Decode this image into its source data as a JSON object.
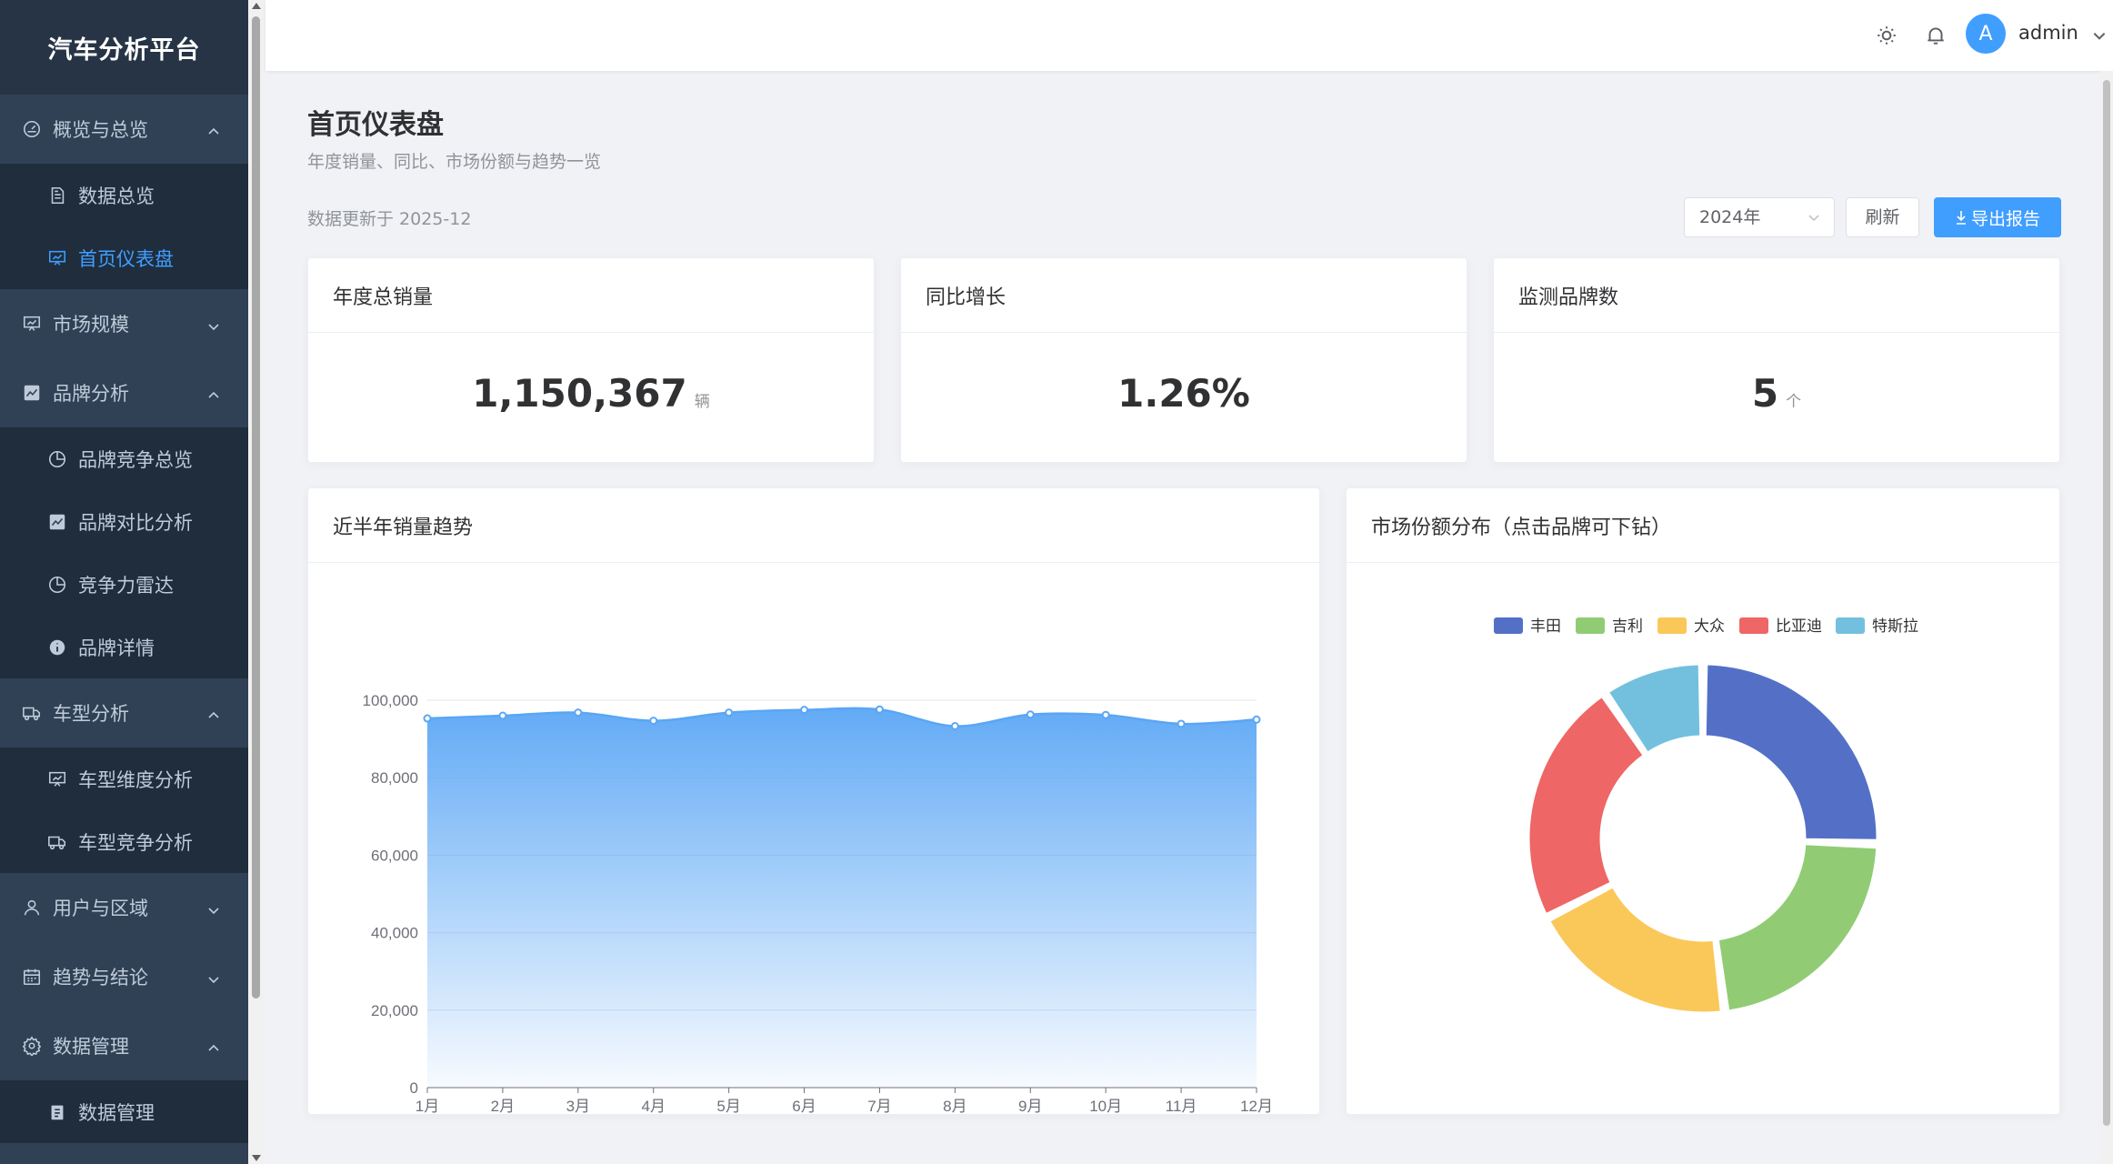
{
  "app": {
    "brand": "汽车分析平台"
  },
  "sidebar": {
    "items": [
      {
        "label": "概览与总览",
        "type": "top",
        "icon": "dashboard-gauge-icon",
        "arrow": "up"
      },
      {
        "label": "数据总览",
        "type": "sub",
        "icon": "document-icon"
      },
      {
        "label": "首页仪表盘",
        "type": "sub",
        "icon": "presentation-chart-icon",
        "active": true
      },
      {
        "label": "市场规模",
        "type": "top",
        "icon": "presentation-chart-icon",
        "arrow": "down"
      },
      {
        "label": "品牌分析",
        "type": "top",
        "icon": "line-chart-icon",
        "arrow": "up"
      },
      {
        "label": "品牌竞争总览",
        "type": "sub",
        "icon": "pie-chart-icon"
      },
      {
        "label": "品牌对比分析",
        "type": "sub",
        "icon": "line-chart-icon"
      },
      {
        "label": "竞争力雷达",
        "type": "sub",
        "icon": "pie-chart-icon"
      },
      {
        "label": "品牌详情",
        "type": "sub",
        "icon": "info-icon"
      },
      {
        "label": "车型分析",
        "type": "top",
        "icon": "truck-icon",
        "arrow": "up"
      },
      {
        "label": "车型维度分析",
        "type": "sub",
        "icon": "presentation-chart-icon"
      },
      {
        "label": "车型竞争分析",
        "type": "sub",
        "icon": "truck-icon"
      },
      {
        "label": "用户与区域",
        "type": "top",
        "icon": "user-icon",
        "arrow": "down"
      },
      {
        "label": "趋势与结论",
        "type": "top",
        "icon": "calendar-icon",
        "arrow": "down"
      },
      {
        "label": "数据管理",
        "type": "top",
        "icon": "gear-icon",
        "arrow": "up"
      },
      {
        "label": "数据管理",
        "type": "sub",
        "icon": "clipboard-icon"
      }
    ]
  },
  "header": {
    "username": "admin",
    "avatar_letter": "A"
  },
  "page": {
    "title": "首页仪表盘",
    "subtitle": "年度销量、同比、市场份额与趋势一览",
    "updated": "数据更新于 2025-12",
    "year_select": "2024年",
    "refresh_label": "刷新",
    "export_label": "导出报告"
  },
  "kpis": [
    {
      "title": "年度总销量",
      "value": "1,150,367",
      "unit": "辆"
    },
    {
      "title": "同比增长",
      "value": "1.26%",
      "unit": ""
    },
    {
      "title": "监测品牌数",
      "value": "5",
      "unit": "个"
    }
  ],
  "charts": {
    "trend_title": "近半年销量趋势",
    "share_title": "市场份额分布（点击品牌可下钻）"
  },
  "colors": {
    "accent": "#409eff",
    "sidebar_bg": "#304156"
  },
  "chart_data": [
    {
      "type": "area",
      "title": "近半年销量趋势",
      "categories": [
        "1月",
        "2月",
        "3月",
        "4月",
        "5月",
        "6月",
        "7月",
        "8月",
        "9月",
        "10月",
        "11月",
        "12月"
      ],
      "series": [
        {
          "values": [
            95300,
            96000,
            96800,
            94700,
            96800,
            97500,
            97600,
            93300,
            96300,
            96200,
            93900,
            95000
          ]
        }
      ],
      "ylim": [
        0,
        100000
      ],
      "yticks": [
        0,
        20000,
        40000,
        60000,
        80000,
        100000
      ],
      "ytick_labels": [
        "0",
        "20,000",
        "40,000",
        "60,000",
        "80,000",
        "100,000"
      ],
      "grid": true,
      "color": "#5aa6f5"
    },
    {
      "type": "pie",
      "title": "市场份额分布（点击品牌可下钻）",
      "donut": true,
      "legend_position": "top",
      "categories": [
        "丰田",
        "吉利",
        "大众",
        "比亚迪",
        "特斯拉"
      ],
      "values": [
        25.5,
        22.5,
        19.5,
        23.0,
        9.5
      ],
      "colors": [
        "#5470c6",
        "#91cc75",
        "#fac858",
        "#ee6666",
        "#73c0de"
      ]
    }
  ]
}
